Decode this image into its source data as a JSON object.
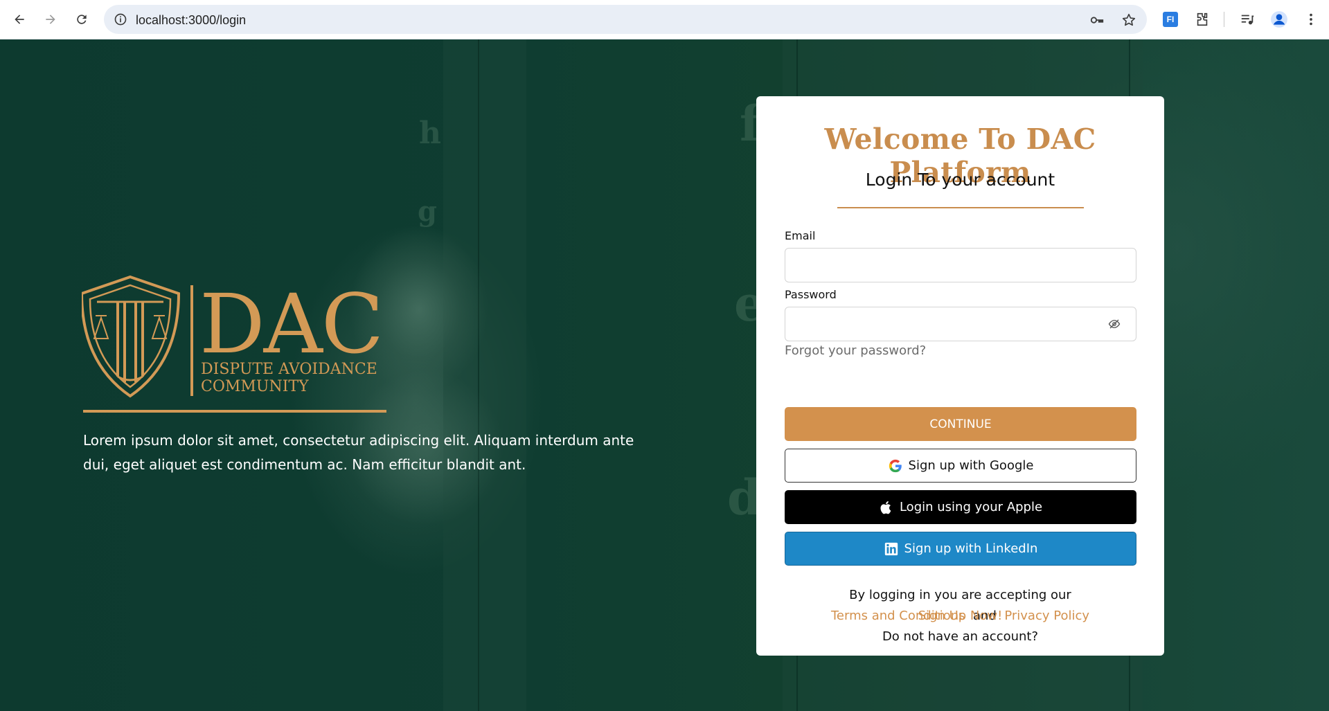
{
  "browser": {
    "url": "localhost:3000/login"
  },
  "brand": {
    "logo_text": "DAC",
    "logo_line1": "DISPUTE AVOIDANCE",
    "logo_line2": "COMMUNITY",
    "tagline": "Lorem ipsum dolor sit amet, consectetur adipiscing elit. Aliquam interdum ante dui, eget aliquet est condimentum ac. Nam efficitur blandit ant.",
    "accent_color": "#d3914d",
    "background_color": "#0f3b30"
  },
  "login": {
    "title": "Welcome To DAC Platform",
    "subtitle": "Login To your account",
    "email_label": "Email",
    "email_value": "",
    "password_label": "Password",
    "password_value": "",
    "forgot": "Forgot your password?",
    "continue": "CONTINUE",
    "google": "Sign up with Google",
    "apple": "Login using your Apple",
    "linkedin": "Sign up with LinkedIn",
    "consent": "By logging in you are accepting our",
    "terms": "Terms and Conditions",
    "and": "and",
    "privacy": "Privacy Policy",
    "no_account": "Do not have an account?",
    "signup": "Sign Up Now!"
  }
}
